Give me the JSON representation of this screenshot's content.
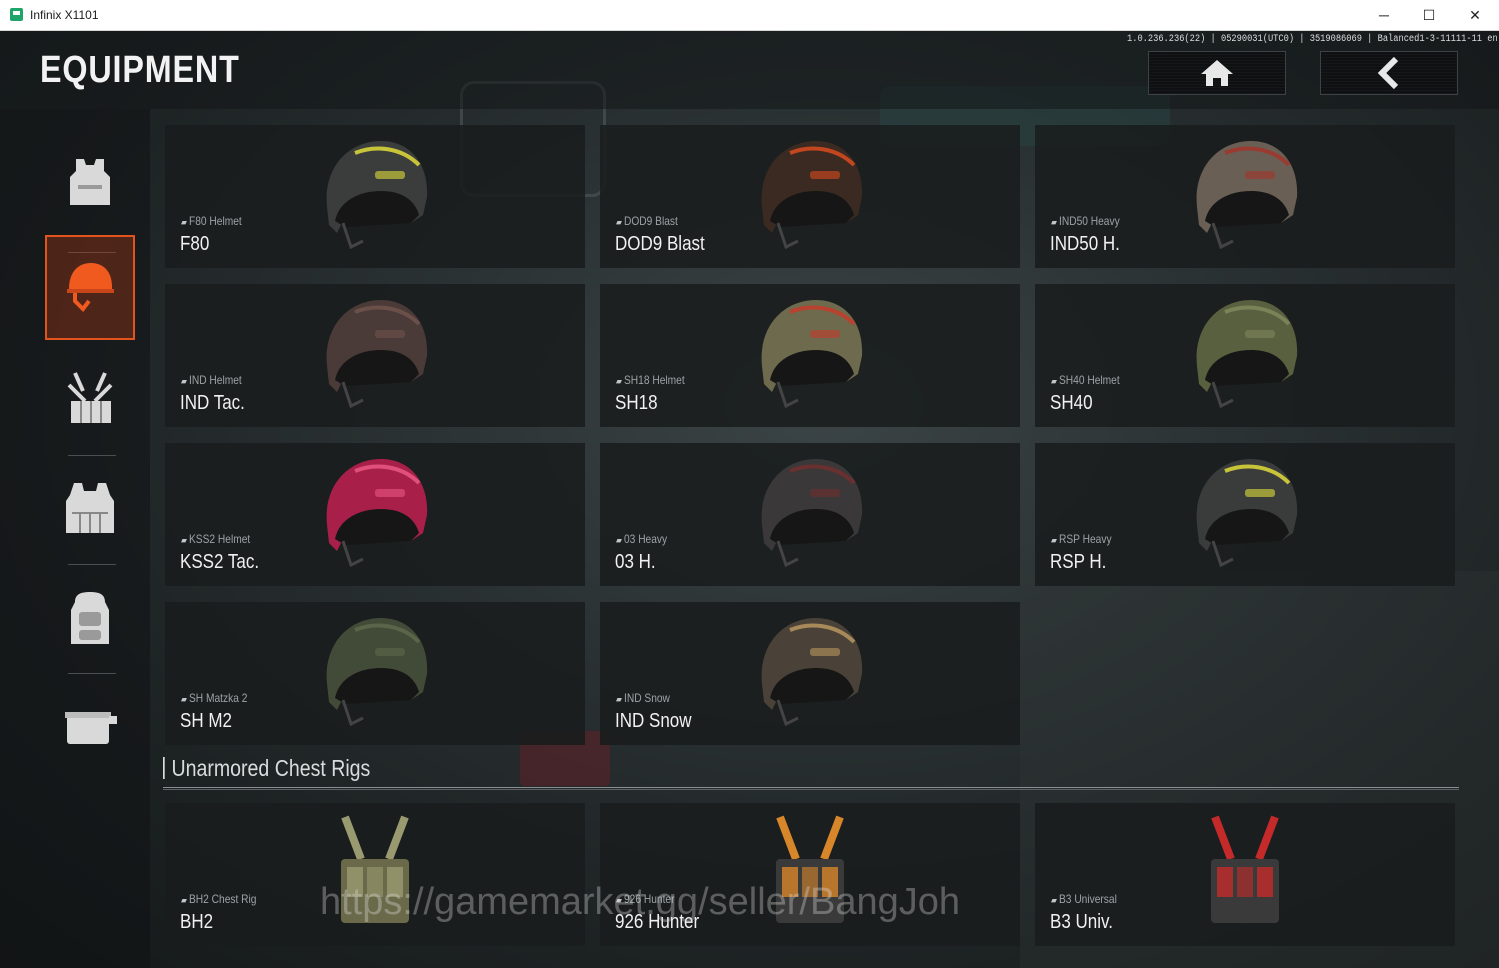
{
  "window": {
    "title": "Infinix X1101",
    "minimize": "─",
    "maximize": "☐",
    "close": "✕"
  },
  "header": {
    "title": "EQUIPMENT",
    "build_info": "1.0.236.236(22) | 05290031(UTC0) | 3519086069 | Balanced1-3-11111-11 en",
    "home_icon": "home-icon",
    "back_icon": "back-icon"
  },
  "sidebar": {
    "items": [
      {
        "icon": "body-armor-icon",
        "active": false
      },
      {
        "icon": "helmet-icon",
        "active": true
      },
      {
        "icon": "chest-rig-icon",
        "active": false
      },
      {
        "icon": "armored-rig-icon",
        "active": false
      },
      {
        "icon": "backpack-icon",
        "active": false
      },
      {
        "icon": "pouch-icon",
        "active": false
      }
    ]
  },
  "helmets": [
    {
      "category": "F80 Helmet",
      "name": "F80",
      "color": "#3a3d3c",
      "accent": "#c8c43a"
    },
    {
      "category": "DOD9 Blast",
      "name": "DOD9 Blast",
      "color": "#3a2a22",
      "accent": "#c2461e"
    },
    {
      "category": "IND50 Heavy",
      "name": "IND50 H.",
      "color": "#6a5f55",
      "accent": "#9a3a30"
    },
    {
      "category": "IND Helmet",
      "name": "IND Tac.",
      "color": "#4a3a38",
      "accent": "#6a5048"
    },
    {
      "category": "SH18 Helmet",
      "name": "SH18",
      "color": "#6d6a4e",
      "accent": "#b9422e"
    },
    {
      "category": "SH40 Helmet",
      "name": "SH40",
      "color": "#58603f",
      "accent": "#7a8258"
    },
    {
      "category": "KSS2 Helmet",
      "name": "KSS2 Tac.",
      "color": "#a8204a",
      "accent": "#e0507a"
    },
    {
      "category": "03 Heavy",
      "name": "03 H.",
      "color": "#3a3838",
      "accent": "#6a3030"
    },
    {
      "category": "RSP Heavy",
      "name": "RSP H.",
      "color": "#3a3c3c",
      "accent": "#c8c43a"
    },
    {
      "category": "SH Matzka 2",
      "name": "SH M2",
      "color": "#424a38",
      "accent": "#5a6448"
    },
    {
      "category": "IND Snow",
      "name": "IND Snow",
      "color": "#4a4238",
      "accent": "#a88a5a"
    }
  ],
  "chest_rigs_section": {
    "title": "Unarmored Chest Rigs"
  },
  "chest_rigs": [
    {
      "category": "BH2 Chest Rig",
      "name": "BH2",
      "color": "#6a6a4a",
      "accent": "#9a9a70"
    },
    {
      "category": "926 Hunter",
      "name": "926 Hunter",
      "color": "#3a3a3a",
      "accent": "#d8862a"
    },
    {
      "category": "B3 Universal",
      "name": "B3 Univ.",
      "color": "#3a3a3a",
      "accent": "#c42a2a"
    }
  ],
  "watermark": "https://gamemarket.gg/seller/BangJoh"
}
